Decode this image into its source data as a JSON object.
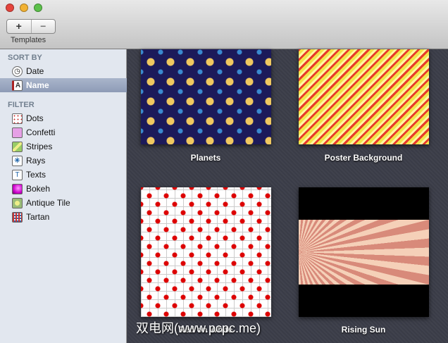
{
  "toolbar": {
    "add_label": "+",
    "remove_label": "−",
    "title": "Templates"
  },
  "sidebar": {
    "sort_header": "SORT BY",
    "sort_items": [
      {
        "label": "Date",
        "icon": "clock-icon"
      },
      {
        "label": "Name",
        "icon": "name-doc-icon",
        "selected": true
      }
    ],
    "filter_header": "FILTER",
    "filter_items": [
      {
        "label": "Dots"
      },
      {
        "label": "Confetti"
      },
      {
        "label": "Stripes"
      },
      {
        "label": "Rays"
      },
      {
        "label": "Texts"
      },
      {
        "label": "Bokeh"
      },
      {
        "label": "Antique Tile"
      },
      {
        "label": "Tartan"
      }
    ]
  },
  "templates": [
    {
      "name": "Planets"
    },
    {
      "name": "Poster Background"
    },
    {
      "name": "Red on White"
    },
    {
      "name": "Rising Sun"
    }
  ],
  "watermark": "双电网(www.pcpc.me)"
}
